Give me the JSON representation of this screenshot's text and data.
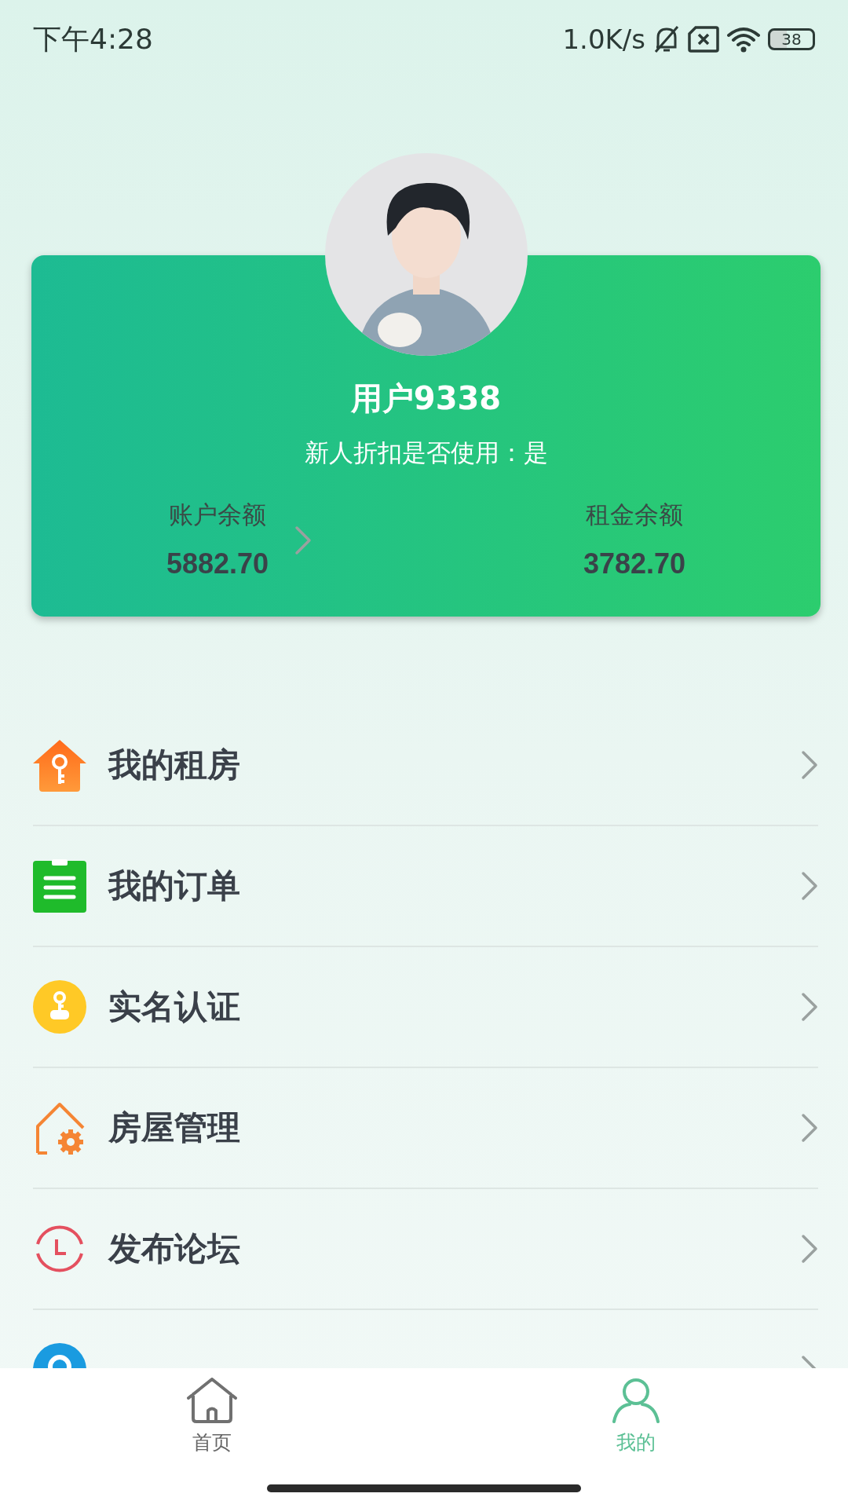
{
  "status_bar": {
    "time": "下午4:28",
    "net_speed": "1.0K/s",
    "battery": "38"
  },
  "profile": {
    "username": "用户9338",
    "discount_line": "新人折扣是否使用：是",
    "stats": [
      {
        "label": "账户余额",
        "value": "5882.70",
        "has_arrow": true
      },
      {
        "label": "租金余额",
        "value": "3782.70",
        "has_arrow": false
      }
    ]
  },
  "menu": [
    {
      "kind": "rent",
      "label": "我的租房"
    },
    {
      "kind": "orders",
      "label": "我的订单"
    },
    {
      "kind": "verify",
      "label": "实名认证"
    },
    {
      "kind": "house",
      "label": "房屋管理"
    },
    {
      "kind": "forum",
      "label": "发布论坛"
    },
    {
      "kind": "service"
    }
  ],
  "tabs": [
    {
      "kind": "home",
      "label": "首页",
      "selected": false
    },
    {
      "kind": "me",
      "label": "我的",
      "selected": true
    }
  ]
}
